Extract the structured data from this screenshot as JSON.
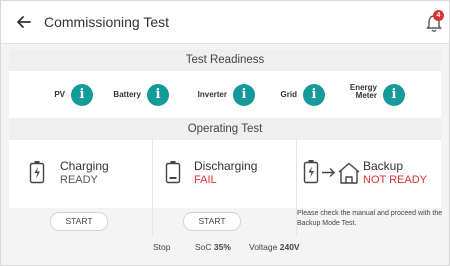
{
  "header": {
    "back_icon": "arrow-left-icon",
    "title": "Commissioning Test",
    "notification_icon": "bell-icon",
    "notification_count": "4"
  },
  "test_readiness": {
    "heading": "Test Readiness",
    "items": [
      {
        "label": "PV",
        "icon": "info-icon"
      },
      {
        "label": "Battery",
        "icon": "info-icon"
      },
      {
        "label": "Inverter",
        "icon": "info-icon"
      },
      {
        "label": "Grid",
        "icon": "info-icon"
      },
      {
        "label_line1": "Energy",
        "label_line2": "Meter",
        "icon": "info-icon"
      }
    ]
  },
  "operating_test": {
    "heading": "Operating Test",
    "charging": {
      "name": "Charging",
      "status": "READY",
      "icon": "battery-charging-icon",
      "button": "START"
    },
    "discharging": {
      "name": "Discharging",
      "status": "FAIL",
      "icon": "battery-discharging-icon",
      "button": "START"
    },
    "backup": {
      "name": "Backup",
      "status": "NOT READY",
      "icon": "battery-to-house-icon",
      "note": "Please check the manual and proceed with the Backup Mode Test."
    }
  },
  "footer": {
    "state": "Stop",
    "soc_label": "SoC",
    "soc_value": "35%",
    "voltage_label": "Voltage",
    "voltage_value": "240V"
  },
  "colors": {
    "accent": "#159a9b",
    "error": "#d83232"
  }
}
